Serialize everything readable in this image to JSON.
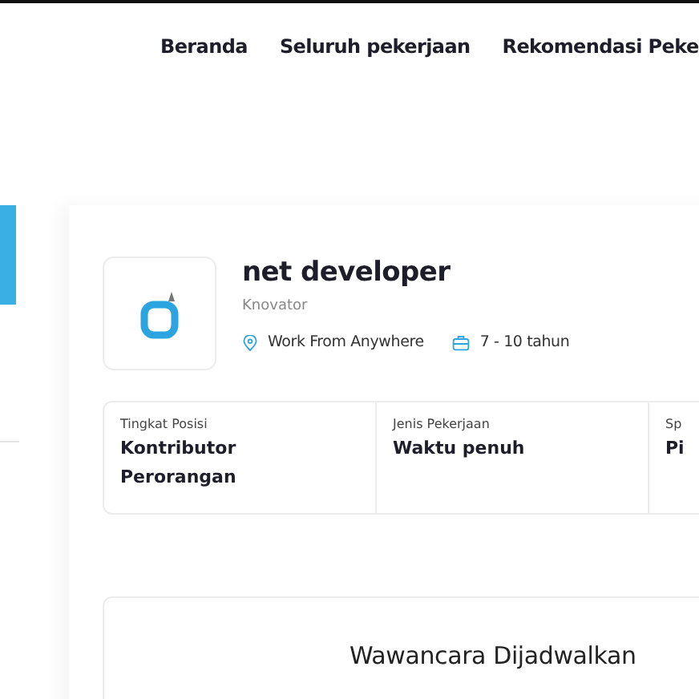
{
  "nav": {
    "items": [
      {
        "label": "Beranda"
      },
      {
        "label": "Seluruh pekerjaan"
      },
      {
        "label": "Rekomendasi Peke"
      }
    ]
  },
  "job": {
    "title": "net developer",
    "company": "Knovator",
    "location": "Work From Anywhere",
    "experience": "7 - 10 tahun"
  },
  "details": [
    {
      "label": "Tingkat Posisi",
      "value": "Kontributor Perorangan"
    },
    {
      "label": "Jenis Pekerjaan",
      "value": "Waktu penuh"
    },
    {
      "label": "Sp",
      "value": "Pi"
    }
  ],
  "status": {
    "title": "Wawancara Dijadwalkan"
  }
}
